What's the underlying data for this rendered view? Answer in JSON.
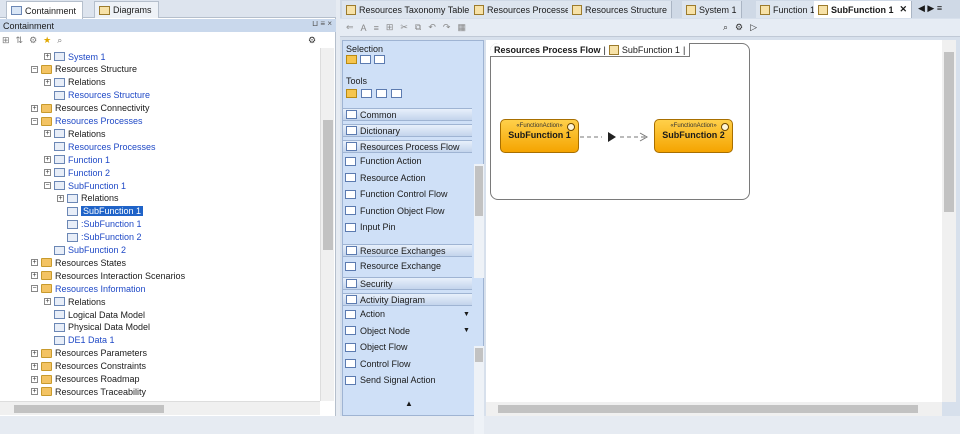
{
  "left": {
    "tabs": [
      {
        "label": "Containment",
        "icon": "containment-icon"
      },
      {
        "label": "Diagrams",
        "icon": "diagrams-icon"
      }
    ],
    "panel_title": "Containment",
    "panel_controls": "⊔ ≡ ×",
    "tree": [
      {
        "label": "System 1",
        "indent": 4,
        "icon": "system-icon",
        "expand": "+",
        "blue": true
      },
      {
        "label": "Resources Structure",
        "indent": 3,
        "icon": "folder",
        "expand": "−"
      },
      {
        "label": "Relations",
        "indent": 4,
        "icon": "relations-icon",
        "expand": "+"
      },
      {
        "label": "Resources Structure",
        "indent": 4,
        "icon": "diagram-icon",
        "blue": true
      },
      {
        "label": "Resources Connectivity",
        "indent": 3,
        "icon": "folder",
        "expand": "+"
      },
      {
        "label": "Resources Processes",
        "indent": 3,
        "icon": "folder",
        "expand": "−",
        "blue": true
      },
      {
        "label": "Relations",
        "indent": 4,
        "icon": "relations-icon",
        "expand": "+"
      },
      {
        "label": "Resources Processes",
        "indent": 4,
        "icon": "diagram-icon",
        "blue": true
      },
      {
        "label": "Function 1",
        "indent": 4,
        "icon": "function-icon",
        "expand": "+",
        "blue": true
      },
      {
        "label": "Function 2",
        "indent": 4,
        "icon": "function-icon",
        "expand": "+",
        "blue": true
      },
      {
        "label": "SubFunction 1",
        "indent": 4,
        "icon": "function-icon",
        "expand": "−",
        "blue": true
      },
      {
        "label": "Relations",
        "indent": 5,
        "icon": "relations-icon",
        "expand": "+"
      },
      {
        "label": "SubFunction 1",
        "indent": 5,
        "icon": "diagram-icon",
        "selected": true
      },
      {
        "label": ":SubFunction 1",
        "indent": 5,
        "icon": "action-icon",
        "blue": true
      },
      {
        "label": ":SubFunction 2",
        "indent": 5,
        "icon": "action-icon",
        "blue": true
      },
      {
        "label": "SubFunction 2",
        "indent": 4,
        "icon": "function-icon",
        "blue": true
      },
      {
        "label": "Resources States",
        "indent": 3,
        "icon": "folder",
        "expand": "+"
      },
      {
        "label": "Resources Interaction Scenarios",
        "indent": 3,
        "icon": "folder",
        "expand": "+"
      },
      {
        "label": "Resources Information",
        "indent": 3,
        "icon": "folder",
        "expand": "−",
        "blue": true
      },
      {
        "label": "Relations",
        "indent": 4,
        "icon": "relations-icon",
        "expand": "+"
      },
      {
        "label": "Logical Data Model",
        "indent": 4,
        "icon": "diagram-icon"
      },
      {
        "label": "Physical Data Model",
        "indent": 4,
        "icon": "diagram-icon"
      },
      {
        "label": "DE1 Data 1",
        "indent": 4,
        "icon": "data-icon",
        "blue": true
      },
      {
        "label": "Resources Parameters",
        "indent": 3,
        "icon": "folder",
        "expand": "+"
      },
      {
        "label": "Resources Constraints",
        "indent": 3,
        "icon": "folder",
        "expand": "+"
      },
      {
        "label": "Resources Roadmap",
        "indent": 3,
        "icon": "folder",
        "expand": "+"
      },
      {
        "label": "Resources Traceability",
        "indent": 3,
        "icon": "folder",
        "expand": "+"
      }
    ]
  },
  "right": {
    "tabs": [
      {
        "label": "Resources Taxonomy Table",
        "active": false
      },
      {
        "label": "Resources Processes",
        "active": false
      },
      {
        "label": "Resources Structure",
        "active": false
      },
      {
        "label": "System 1",
        "active": false
      },
      {
        "label": "Function 1",
        "active": false
      },
      {
        "label": "SubFunction 1",
        "active": true
      }
    ],
    "tab_nav": "◀ ▶ ≡",
    "palette": {
      "sections": [
        {
          "label": "Selection",
          "type": "plain"
        },
        {
          "label": "Tools",
          "type": "plain"
        },
        {
          "label": "Common",
          "type": "head"
        },
        {
          "label": "Dictionary",
          "type": "head"
        },
        {
          "label": "Resources Process Flow",
          "type": "head"
        }
      ],
      "process_flow_items": [
        "Function Action",
        "Resource Action",
        "Function Control Flow",
        "Function Object Flow",
        "Input Pin"
      ],
      "sections2": [
        {
          "label": "Resource Exchanges",
          "type": "head"
        }
      ],
      "exchange_items": [
        "Resource Exchange"
      ],
      "sections3": [
        {
          "label": "Security",
          "type": "head"
        },
        {
          "label": "Activity Diagram",
          "type": "head"
        }
      ],
      "activity_items": [
        "Action",
        "Object Node",
        "Object Flow",
        "Control Flow",
        "Send Signal Action"
      ]
    },
    "diagram": {
      "frame_label": "Resources Process Flow",
      "frame_ref": "SubFunction 1",
      "actions": [
        {
          "stereotype": "«FunctionAction»",
          "name": "SubFunction 1"
        },
        {
          "stereotype": "«FunctionAction»",
          "name": "SubFunction 2"
        }
      ]
    }
  },
  "colors": {
    "action_fill": "#f5a400",
    "selection": "#1f63c8",
    "link_blue": "#1f49c6"
  }
}
